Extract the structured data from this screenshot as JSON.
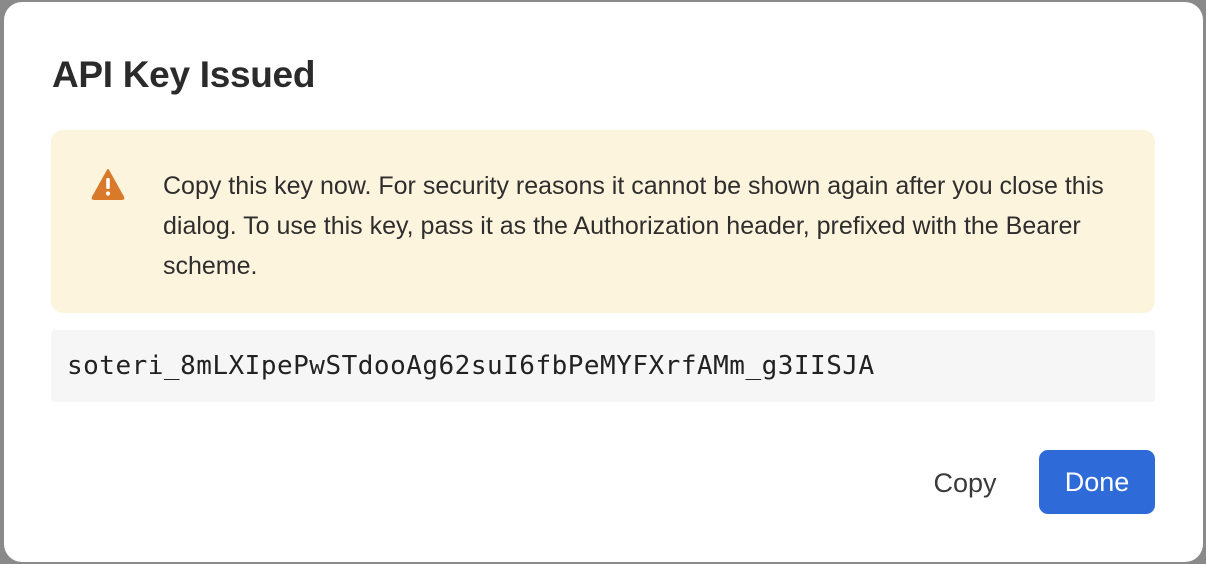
{
  "dialog": {
    "title": "API Key Issued",
    "warning": {
      "icon": "warning-triangle-icon",
      "text": "Copy this key now. For security reasons it cannot be shown again after you close this dialog. To use this key, pass it as the Authorization header, prefixed with the Bearer scheme.",
      "color": "#d97a2b",
      "background": "#fdf4dd"
    },
    "api_key": "soteri_8mLXIpePwSTdooAg62suI6fbPeMYFXrfAMm_g3IISJA",
    "buttons": {
      "copy_label": "Copy",
      "done_label": "Done"
    },
    "accent_color": "#2e6bd8"
  }
}
